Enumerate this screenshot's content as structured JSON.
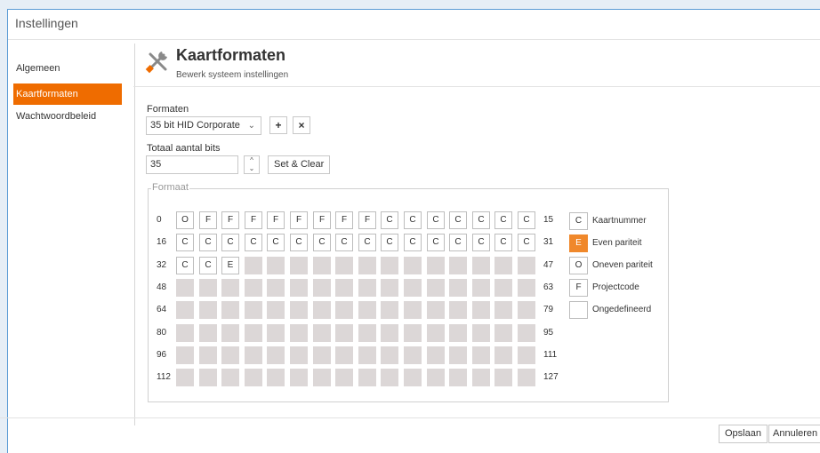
{
  "window": {
    "title": "Instellingen"
  },
  "sidebar": {
    "items": [
      {
        "label": "Algemeen",
        "active": false
      },
      {
        "label": "Kaartformaten",
        "active": true
      },
      {
        "label": "Wachtwoordbeleid",
        "active": false
      }
    ]
  },
  "header": {
    "icon": "tools-icon",
    "title": "Kaartformaten",
    "subtitle": "Bewerk systeem instellingen"
  },
  "form": {
    "formats_label": "Formaten",
    "format_selected": "35 bit HID Corporate",
    "add_label": "+",
    "remove_label": "×",
    "total_bits_label": "Totaal aantal bits",
    "total_bits_value": "35",
    "set_clear_label": "Set & Clear"
  },
  "grid": {
    "legend_title": "Formaat",
    "rows": [
      {
        "start": "0",
        "end": "15",
        "cells": [
          "O",
          "F",
          "F",
          "F",
          "F",
          "F",
          "F",
          "F",
          "F",
          "C",
          "C",
          "C",
          "C",
          "C",
          "C",
          "C"
        ]
      },
      {
        "start": "16",
        "end": "31",
        "cells": [
          "C",
          "C",
          "C",
          "C",
          "C",
          "C",
          "C",
          "C",
          "C",
          "C",
          "C",
          "C",
          "C",
          "C",
          "C",
          "C"
        ]
      },
      {
        "start": "32",
        "end": "47",
        "cells": [
          "C",
          "C",
          "E",
          "",
          "",
          "",
          "",
          "",
          "",
          "",
          "",
          "",
          "",
          "",
          "",
          ""
        ]
      },
      {
        "start": "48",
        "end": "63",
        "cells": [
          "",
          "",
          "",
          "",
          "",
          "",
          "",
          "",
          "",
          "",
          "",
          "",
          "",
          "",
          "",
          ""
        ]
      },
      {
        "start": "64",
        "end": "79",
        "cells": [
          "",
          "",
          "",
          "",
          "",
          "",
          "",
          "",
          "",
          "",
          "",
          "",
          "",
          "",
          "",
          ""
        ]
      },
      {
        "start": "80",
        "end": "95",
        "cells": [
          "",
          "",
          "",
          "",
          "",
          "",
          "",
          "",
          "",
          "",
          "",
          "",
          "",
          "",
          "",
          ""
        ]
      },
      {
        "start": "96",
        "end": "111",
        "cells": [
          "",
          "",
          "",
          "",
          "",
          "",
          "",
          "",
          "",
          "",
          "",
          "",
          "",
          "",
          "",
          ""
        ]
      },
      {
        "start": "112",
        "end": "127",
        "cells": [
          "",
          "",
          "",
          "",
          "",
          "",
          "",
          "",
          "",
          "",
          "",
          "",
          "",
          "",
          "",
          ""
        ]
      }
    ],
    "defined_count": 35
  },
  "legend": [
    {
      "code": "C",
      "label": "Kaartnummer",
      "style": "plain"
    },
    {
      "code": "E",
      "label": "Even pariteit",
      "style": "even"
    },
    {
      "code": "O",
      "label": "Oneven pariteit",
      "style": "plain"
    },
    {
      "code": "F",
      "label": "Projectcode",
      "style": "plain"
    },
    {
      "code": "",
      "label": "Ongedefineerd",
      "style": "plain"
    }
  ],
  "footer": {
    "save_label": "Opslaan",
    "cancel_label": "Annuleren"
  },
  "colors": {
    "accent": "#ef6c00",
    "even_parity": "#f0882b",
    "undefined_cell": "#dcd7d7",
    "window_border": "#5b9bd5"
  }
}
